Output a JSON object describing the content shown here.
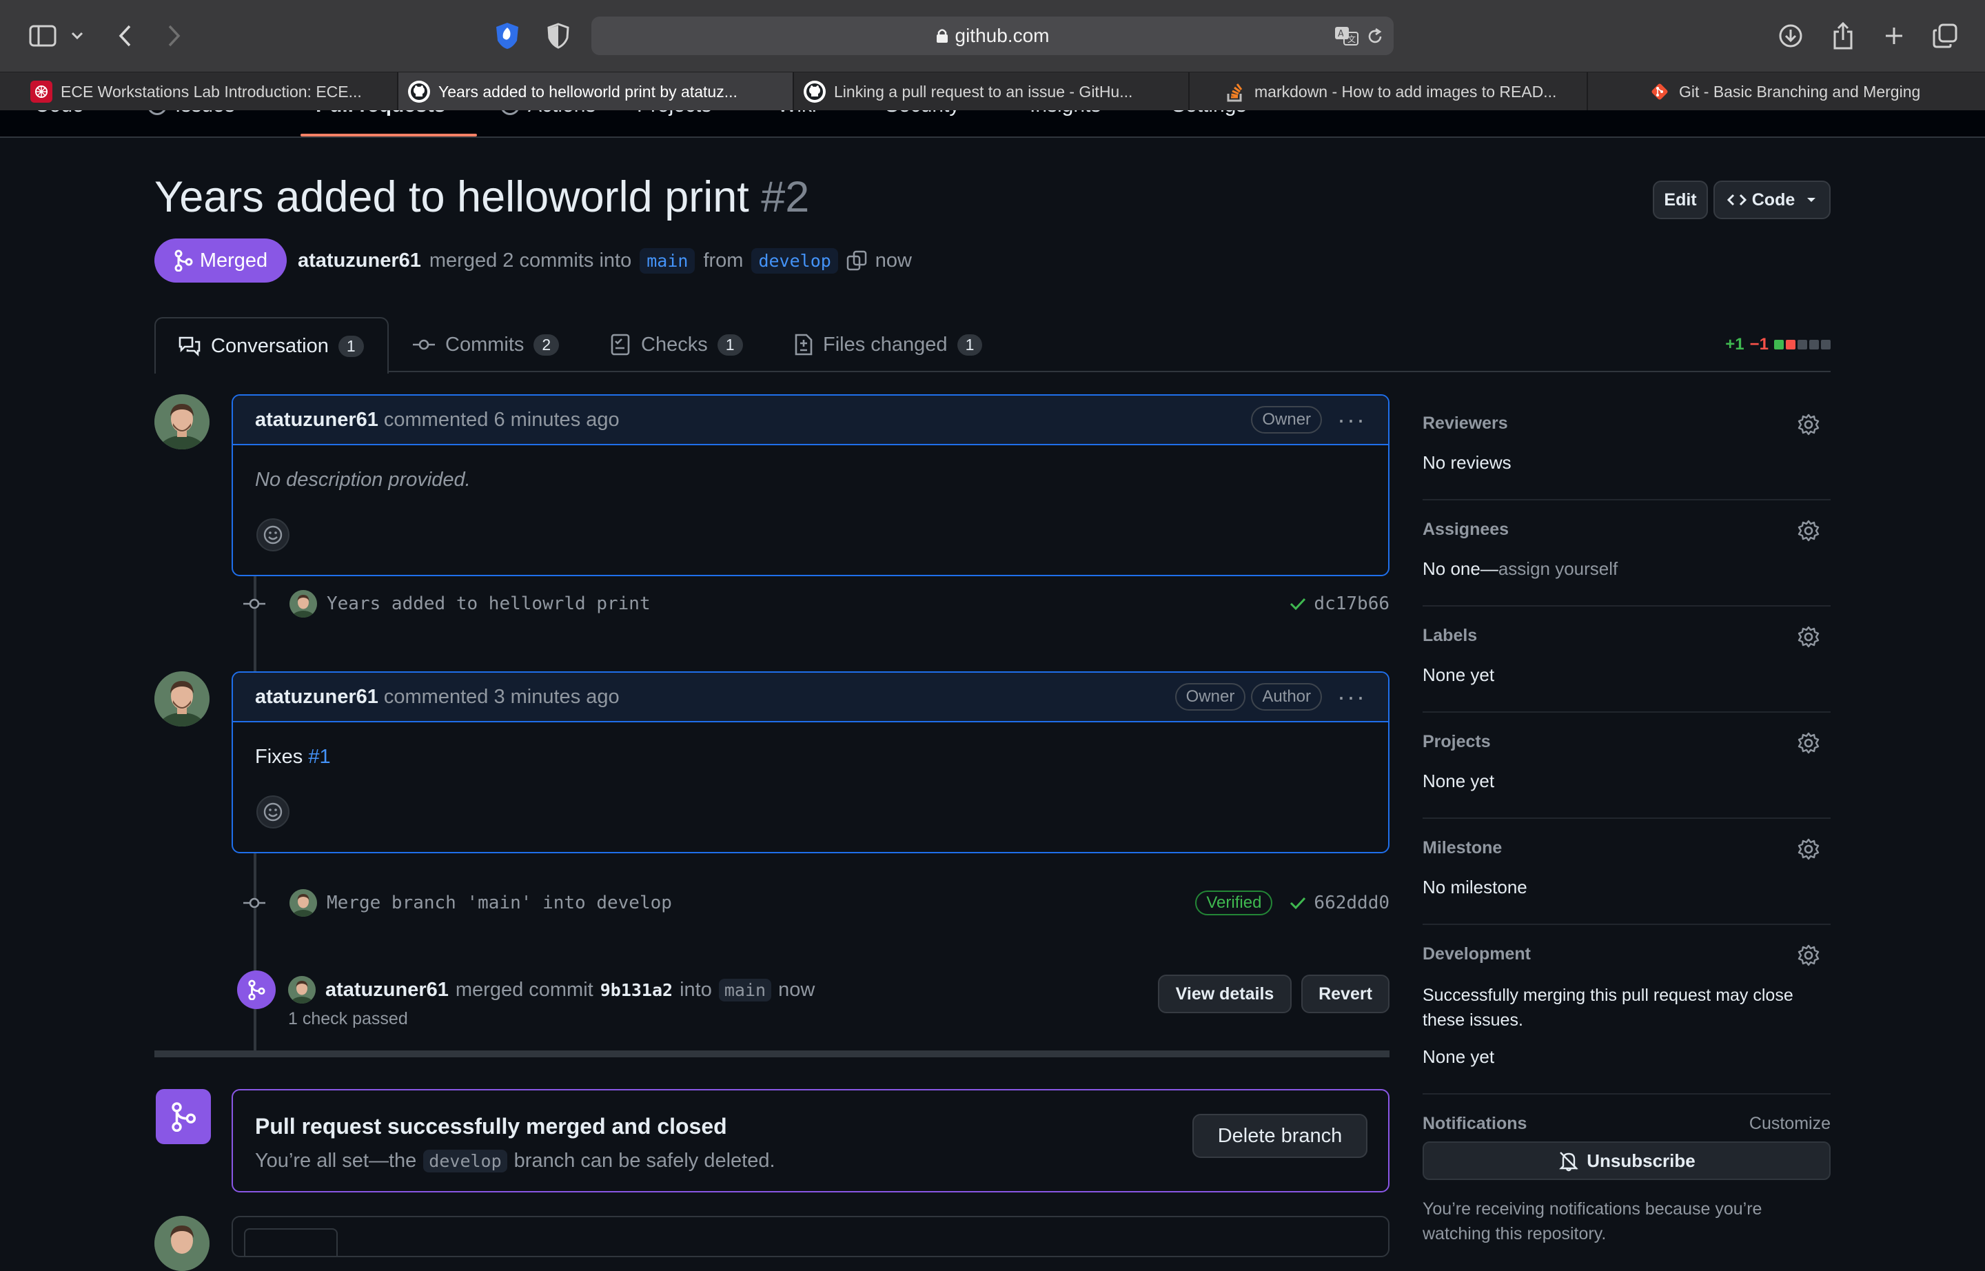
{
  "browser": {
    "url": "github.com",
    "tabs": [
      {
        "title": "ECE Workstations Lab Introduction: ECE...",
        "icon": "university-icon"
      },
      {
        "title": "Years added to helloworld print by atatuz...",
        "icon": "github-icon",
        "active": true
      },
      {
        "title": "Linking a pull request to an issue - GitHu...",
        "icon": "github-icon"
      },
      {
        "title": "markdown - How to add images to READ...",
        "icon": "stackoverflow-icon"
      },
      {
        "title": "Git - Basic Branching and Merging",
        "icon": "git-icon"
      }
    ]
  },
  "repo_nav": {
    "items": [
      "Code",
      "Issues",
      "Pull requests",
      "Actions",
      "Projects",
      "Wiki",
      "Security",
      "Insights",
      "Settings"
    ]
  },
  "pr": {
    "title": "Years added to helloworld print",
    "number": "#2",
    "edit_label": "Edit",
    "code_label": "Code",
    "state": "Merged",
    "author": "atatuzuner61",
    "merged_text": "merged 2 commits into",
    "base_branch": "main",
    "from_text": "from",
    "head_branch": "develop",
    "time": "now"
  },
  "tabs": [
    {
      "label": "Conversation",
      "count": "1"
    },
    {
      "label": "Commits",
      "count": "2"
    },
    {
      "label": "Checks",
      "count": "1"
    },
    {
      "label": "Files changed",
      "count": "1"
    }
  ],
  "diffstat": {
    "added": "+1",
    "removed": "−1",
    "colors": {
      "added": "#3fb950",
      "removed": "#f85149"
    }
  },
  "timeline": {
    "comment1": {
      "author": "atatuzuner61",
      "meta": "commented 6 minutes ago",
      "badges": [
        "Owner"
      ],
      "body": "No description provided."
    },
    "commit1": {
      "message": "Years added to hellowrld print",
      "sha": "dc17b66"
    },
    "comment2": {
      "author": "atatuzuner61",
      "meta": "commented 3 minutes ago",
      "badges": [
        "Owner",
        "Author"
      ],
      "body_prefix": "Fixes",
      "body_link": "#1"
    },
    "commit2": {
      "message": "Merge branch 'main' into develop",
      "verified": "Verified",
      "sha": "662ddd0"
    },
    "merged": {
      "author": "atatuzuner61",
      "text1": "merged commit",
      "commit": "9b131a2",
      "text2": "into",
      "branch": "main",
      "time": "now",
      "checks": "1 check passed",
      "view_details": "View details",
      "revert": "Revert"
    },
    "merge_box": {
      "title": "Pull request successfully merged and closed",
      "text_before": "You’re all set—the",
      "branch": "develop",
      "text_after": "branch can be safely deleted.",
      "delete_label": "Delete branch"
    }
  },
  "sidebar": {
    "reviewers": {
      "title": "Reviewers",
      "value": "No reviews"
    },
    "assignees": {
      "title": "Assignees",
      "value": "No one—",
      "link": "assign yourself"
    },
    "labels": {
      "title": "Labels",
      "value": "None yet"
    },
    "projects": {
      "title": "Projects",
      "value": "None yet"
    },
    "milestone": {
      "title": "Milestone",
      "value": "No milestone"
    },
    "development": {
      "title": "Development",
      "desc": "Successfully merging this pull request may close these issues.",
      "value": "None yet"
    },
    "notifications": {
      "title": "Notifications",
      "customize": "Customize",
      "unsubscribe": "Unsubscribe",
      "note": "You’re receiving notifications because you’re watching this repository."
    }
  }
}
